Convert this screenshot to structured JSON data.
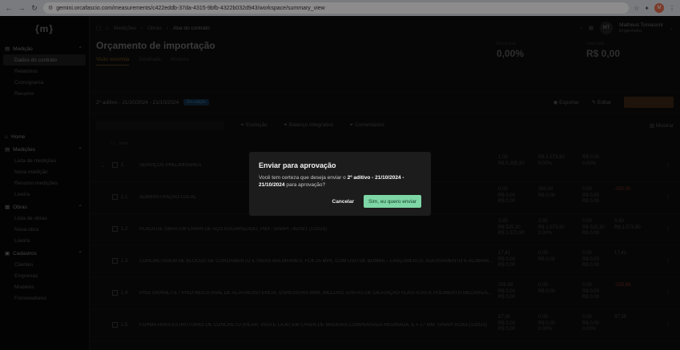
{
  "browser": {
    "url": "gemini.orcafascio.com/measurements/c422eddb-37da-4315-9bfb-4322b032d943/workspace/summary_view",
    "profile_initial": "M"
  },
  "sidebar": {
    "logo": "{m}",
    "sections": [
      {
        "label": "Medição",
        "items": [
          "Dados do contrato",
          "Relatórios",
          "Cronograma",
          "Resumo"
        ]
      },
      {
        "label": "Home",
        "items": []
      },
      {
        "label": "Medições",
        "items": [
          "Lista de medições",
          "Nova medição",
          "Resumo medições",
          "Lixeira"
        ]
      },
      {
        "label": "Obras",
        "items": [
          "Lista de obras",
          "Nova obra",
          "Lixeira"
        ]
      },
      {
        "label": "Cadastros",
        "items": [
          "Clientes",
          "Empresas",
          "Modelos",
          "Fornecedores"
        ]
      }
    ]
  },
  "topbar": {
    "crumbs": [
      "Medições",
      "Obras"
    ],
    "current": "Aba do contrato",
    "user_initials": "MT",
    "user_name": "Matheus Tomasoni",
    "user_role": "Engenheiro"
  },
  "header": {
    "title": "Orçamento de importação",
    "tabs": [
      "Visão resumida",
      "Detalhada",
      "Histórico"
    ],
    "kpis": [
      {
        "label": "Percentual",
        "value": "0,00%"
      },
      {
        "label": "Valor total",
        "value": "R$ 0,00"
      }
    ]
  },
  "version": {
    "label": "2º aditivo - 21/10/2024 - 21/10/2024",
    "badge": "Em edição",
    "actions": [
      "Exportar",
      "Editar"
    ]
  },
  "filters": {
    "items": [
      "Evolução",
      "Balanço integrativo",
      "Comentários"
    ],
    "hide": "Mostrar"
  },
  "table": {
    "header_item": "Item",
    "rows": [
      {
        "num": "1",
        "desc": "SERVIÇOS PRELIMINARES",
        "c1": [
          "1,00",
          "R$ 5.355,90"
        ],
        "c2": [
          "",
          "R$ 1.573,90",
          "0,00%"
        ],
        "c3": [
          "R$ 0,00",
          "0,00%"
        ],
        "c4": [
          ""
        ],
        "red": false
      },
      {
        "num": "1.1",
        "desc": "ADMINISTRAÇÃO LOCAL",
        "c1": [
          "0,00",
          "R$ 0,00",
          "R$ 0,00"
        ],
        "c2": [
          "350,00",
          "",
          "R$ 0,00"
        ],
        "c3": [
          "0,00",
          "R$ 0,00",
          "R$ 0,00"
        ],
        "c4": [
          "-350,00"
        ],
        "red": true
      },
      {
        "num": "1.2",
        "desc": "PLACA DE OBRA EM CHAPA DE AÇO GALVANIZADO, PIEF, SINAPI 74209/1 (1/2023)",
        "c1": [
          "3,00",
          "R$ 525,30",
          "R$ 1.573,90"
        ],
        "c2": [
          "3,00",
          "R$ 1.573,90",
          "0,00%"
        ],
        "c3": [
          "0,00",
          "R$ 525,30",
          "R$ 0,00"
        ],
        "c4": [
          "3,00",
          "R$ 1.573,90"
        ],
        "red": false
      },
      {
        "num": "1.3",
        "desc": "CONCRETAGEM DE BLOCOS DE COROAMENTO E VIGAS BALDRAMES, FCK 25 MPA, COM USO DE BOMBA – LANÇAMENTO, ADENSAMENTO E ACABAM...",
        "c1": [
          "17,41",
          "R$ 0,00",
          "R$ 0,00"
        ],
        "c2": [
          "0,00",
          "",
          "R$ 0,00"
        ],
        "c3": [
          "0,00",
          "R$ 0,00",
          "R$ 0,00"
        ],
        "c4": [
          "17,41"
        ],
        "red": false
      },
      {
        "num": "1.4",
        "desc": "PISO GRANILITE / PISO INDUSTRIAL DE ALTA RESISTÊNCIA, ESPESSURA 8MM, INCLUSO JUNTAS DE DILATAÇÃO PLÁSTICAS E POLIMENTO MECANIZA...",
        "c1": [
          "335,68",
          "R$ 0,00",
          "R$ 0,00"
        ],
        "c2": [
          "0,00",
          "",
          "R$ 0,00"
        ],
        "c3": [
          "0,00",
          "R$ 0,00",
          "R$ 0,00"
        ],
        "c4": [
          "-335,68"
        ],
        "red": true
      },
      {
        "num": "1.5",
        "desc": "FORMA PARA ESTRUTURAS DE CONCRETO (PILAR, VIGA E LAJE) EM CHAPA DE MADEIRA COMPENSADA RESINADA, E = 17 MM, SINAPI 92263 (1/2023)",
        "c1": [
          "87,38",
          "R$ 0,00",
          "R$ 0,00"
        ],
        "c2": [
          "0,00",
          "R$ 0,00",
          "0,00%"
        ],
        "c3": [
          "0,00",
          "R$ 0,00",
          "0,00%"
        ],
        "c4": [
          "87,38"
        ],
        "red": false
      }
    ]
  },
  "modal": {
    "title": "Enviar para aprovação",
    "msg_pre": "Você tem certeza que deseja enviar o ",
    "msg_bold": "2º aditivo - 21/10/2024 - 21/10/2024",
    "msg_post": " para aprovação?",
    "cancel": "Cancelar",
    "confirm": "Sim, eu quero enviar"
  }
}
